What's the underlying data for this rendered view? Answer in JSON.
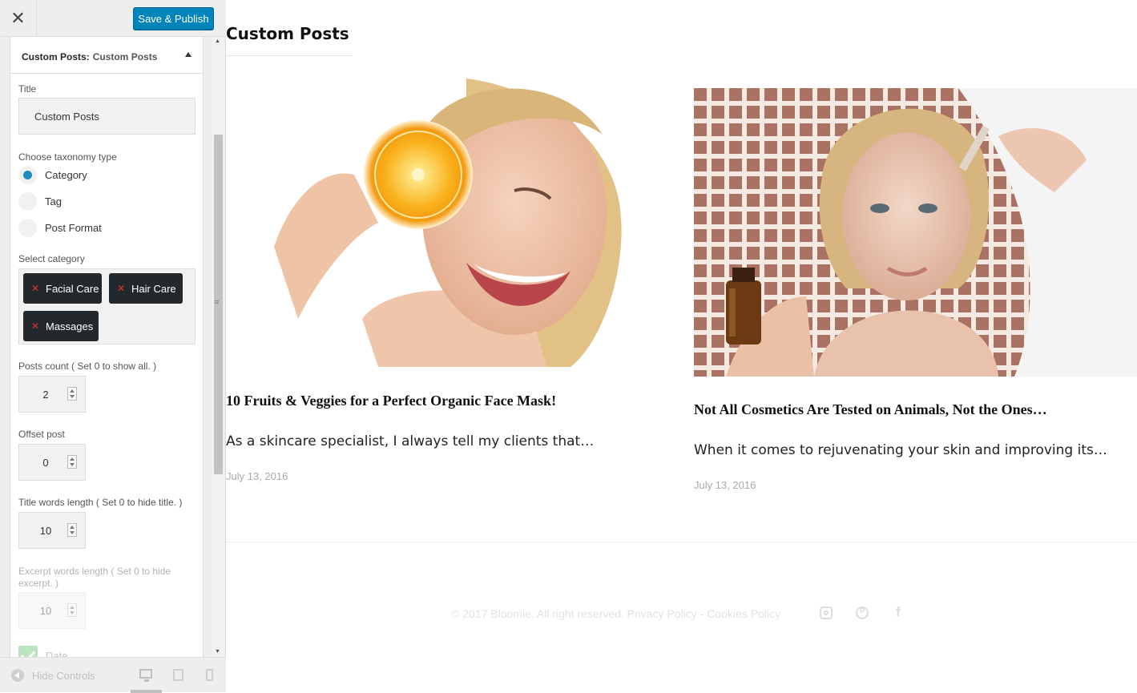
{
  "header": {
    "close_icon": "close-icon",
    "publish_label": "Save & Publish"
  },
  "section": {
    "title_prefix": "Custom Posts:",
    "title_name": "Custom Posts"
  },
  "form": {
    "title_label": "Title",
    "title_value": "Custom Posts",
    "taxonomy_label": "Choose taxonomy type",
    "taxonomy_options": [
      {
        "label": "Category",
        "checked": true
      },
      {
        "label": "Tag",
        "checked": false
      },
      {
        "label": "Post Format",
        "checked": false
      }
    ],
    "category_label": "Select category",
    "categories": [
      "Facial Care",
      "Hair Care",
      "Massages"
    ],
    "posts_count_label": "Posts count ( Set 0 to show all. )",
    "posts_count_value": "2",
    "offset_label": "Offset post",
    "offset_value": "0",
    "title_words_label": "Title words length ( Set 0 to hide title. )",
    "title_words_value": "10",
    "excerpt_words_label": "Excerpt words length ( Set 0 to hide excerpt. )",
    "excerpt_words_value": "10",
    "date_label": "Date"
  },
  "footer_controls": {
    "hide_controls_label": "Hide Controls"
  },
  "preview": {
    "widget_title": "Custom Posts",
    "posts": [
      {
        "title": "10 Fruits & Veggies for a Perfect Organic Face Mask!",
        "excerpt": "As a skincare specialist, I always tell my clients that…",
        "date": "July 13, 2016"
      },
      {
        "title": "Not All Cosmetics Are Tested on Animals, Not the Ones…",
        "excerpt": "When it comes to rejuvenating your skin and improving its…",
        "date": "July 13, 2016"
      }
    ],
    "copyright": "© 2017 Bloomie. All right reserved.",
    "privacy": "Privacy Policy",
    "separator": "-",
    "cookies": "Cookies Policy"
  }
}
